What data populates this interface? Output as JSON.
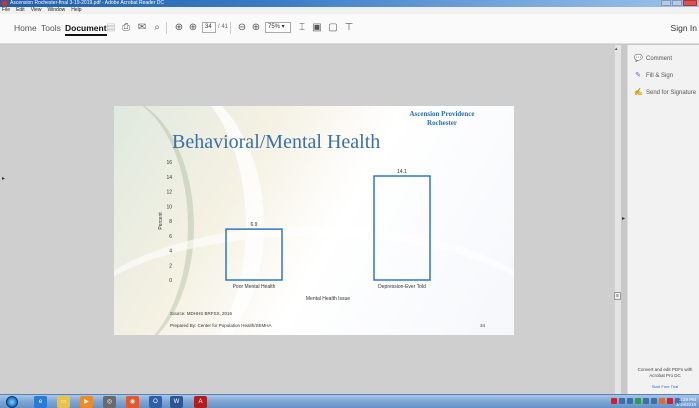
{
  "window": {
    "title": "Ascension Rochester-final 3-19-2019.pdf - Adobe Acrobat Reader DC"
  },
  "menu": [
    "File",
    "Edit",
    "View",
    "Window",
    "Help"
  ],
  "toolbar": {
    "tabs": [
      "Home",
      "Tools",
      "Document"
    ],
    "active_tab": "Document",
    "page_current": "34",
    "page_total": "/ 41",
    "zoom": "75%",
    "signin": "Sign In"
  },
  "slide": {
    "logo_line1": "Ascension Providence",
    "logo_line2": "Rochester",
    "title": "Behavioral/Mental Health",
    "source": "Source: MDHHS BRFSS, 2016",
    "prepared_by": "Prepared By: Center for Population Health/SEMHA",
    "page_number": "34"
  },
  "chart_data": {
    "type": "bar",
    "categories": [
      "Poor Mental Health",
      "Depression-Ever Told"
    ],
    "values": [
      6.9,
      14.1
    ],
    "value_labels": [
      "6.9",
      "14.1"
    ],
    "xlabel": "Mental Health Issue",
    "ylabel": "Percent",
    "ylim": [
      0,
      16
    ],
    "yticks": [
      "0",
      "2",
      "4",
      "6",
      "8",
      "10",
      "12",
      "14",
      "16"
    ],
    "bar_color": "#2e76c7",
    "grid": false
  },
  "right_panel": {
    "items": [
      "Comment",
      "Fill & Sign",
      "Send for Signature"
    ],
    "promo_text": "Convert and edit PDFs with Acrobat Pro DC",
    "promo_link": "Start Free Trial"
  },
  "taskbar": {
    "clock_time": "3:29 PM",
    "clock_date": "3/19/2019"
  }
}
